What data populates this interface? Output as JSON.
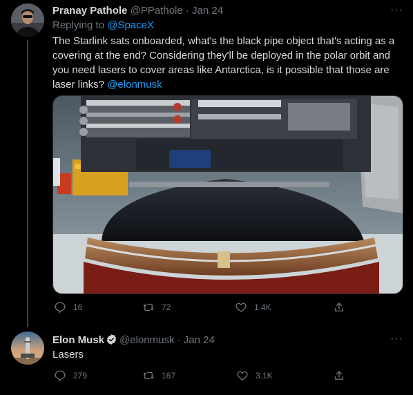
{
  "tweet1": {
    "name": "Pranay Pathole",
    "handle": "@PPathole",
    "separator": "·",
    "date": "Jan 24",
    "replying_prefix": "Replying to",
    "replying_to": "@SpaceX",
    "text_main": "The Starlink sats onboarded, what's the black pipe object that's acting as a covering at the end? Considering they'll be deployed in the polar orbit and you need lasers to cover areas like Antarctica, is it possible that those are laser links?",
    "text_mention": "@elonmusk",
    "more_label": "···",
    "stats": {
      "replies": "16",
      "retweets": "72",
      "likes": "1.4K"
    }
  },
  "tweet2": {
    "name": "Elon Musk",
    "handle": "@elonmusk",
    "separator": "·",
    "date": "Jan 24",
    "text": "Lasers",
    "more_label": "···",
    "stats": {
      "replies": "279",
      "retweets": "167",
      "likes": "3.1K"
    }
  },
  "icons": [
    "reply-icon",
    "retweet-icon",
    "like-icon",
    "share-icon",
    "verified-badge-icon",
    "more-icon"
  ],
  "colors": {
    "background": "#000000",
    "text": "#d9d9d9",
    "muted": "#6e767d",
    "link": "#1d9bf0",
    "verified": "#1d9bf0"
  }
}
